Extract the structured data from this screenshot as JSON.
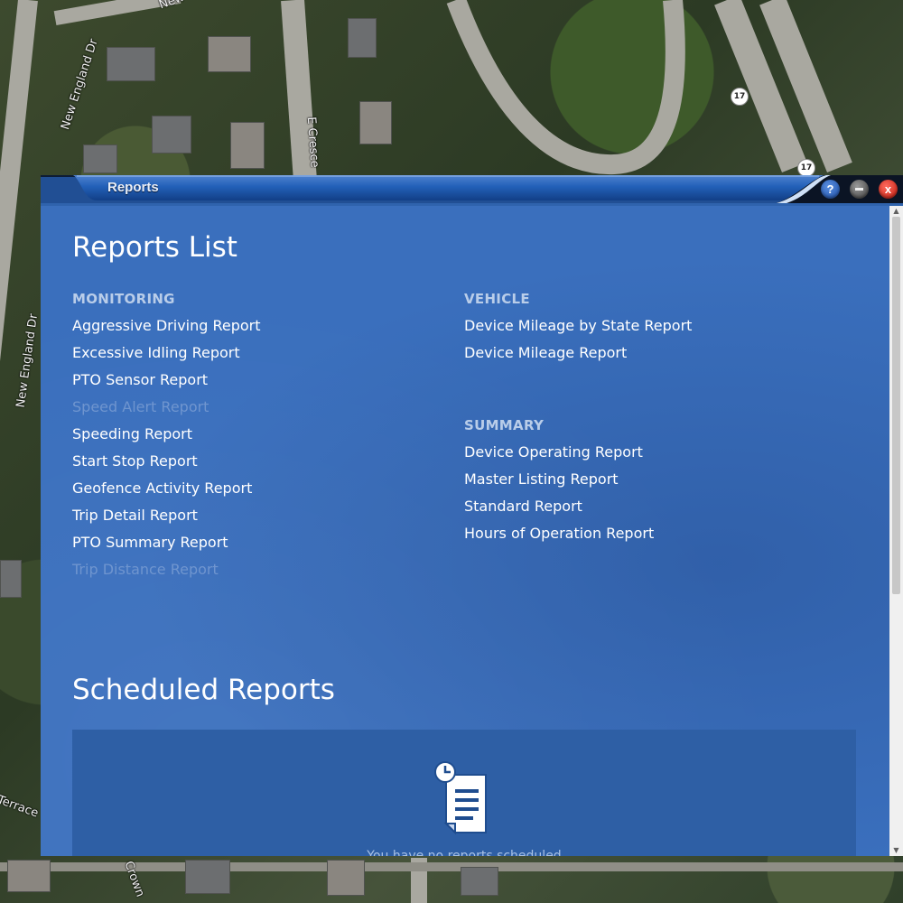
{
  "map": {
    "labels": [
      "New England Dr",
      "New England Dr",
      "E Cresce",
      "New",
      "Terrace",
      "Crown"
    ],
    "route_shields": [
      "17",
      "17"
    ]
  },
  "window": {
    "title": "Reports",
    "buttons": {
      "help": "?",
      "minimize": "",
      "close": "x"
    }
  },
  "reports_list": {
    "heading": "Reports List",
    "monitoring": {
      "title": "MONITORING",
      "items": [
        {
          "label": "Aggressive Driving Report",
          "enabled": true
        },
        {
          "label": "Excessive Idling Report",
          "enabled": true
        },
        {
          "label": "PTO Sensor Report",
          "enabled": true
        },
        {
          "label": "Speed Alert Report",
          "enabled": false
        },
        {
          "label": "Speeding Report",
          "enabled": true
        },
        {
          "label": "Start Stop Report",
          "enabled": true
        },
        {
          "label": "Geofence Activity Report",
          "enabled": true
        },
        {
          "label": "Trip Detail Report",
          "enabled": true
        },
        {
          "label": "PTO Summary Report",
          "enabled": true
        },
        {
          "label": "Trip Distance Report",
          "enabled": false
        }
      ]
    },
    "vehicle": {
      "title": "VEHICLE",
      "items": [
        {
          "label": "Device Mileage by State Report",
          "enabled": true
        },
        {
          "label": "Device Mileage Report",
          "enabled": true
        }
      ]
    },
    "summary": {
      "title": "SUMMARY",
      "items": [
        {
          "label": "Device Operating Report",
          "enabled": true
        },
        {
          "label": "Master Listing Report",
          "enabled": true
        },
        {
          "label": "Standard Report",
          "enabled": true
        },
        {
          "label": "Hours of Operation Report",
          "enabled": true
        }
      ]
    }
  },
  "scheduled_reports": {
    "heading": "Scheduled Reports",
    "empty_message": "You have no reports scheduled"
  },
  "colors": {
    "panel": "#3a6fbd",
    "titlebar": "#1d4f9f",
    "link": "#ffffff",
    "link_disabled": "#6f95cf",
    "section": "#b9cde9"
  }
}
